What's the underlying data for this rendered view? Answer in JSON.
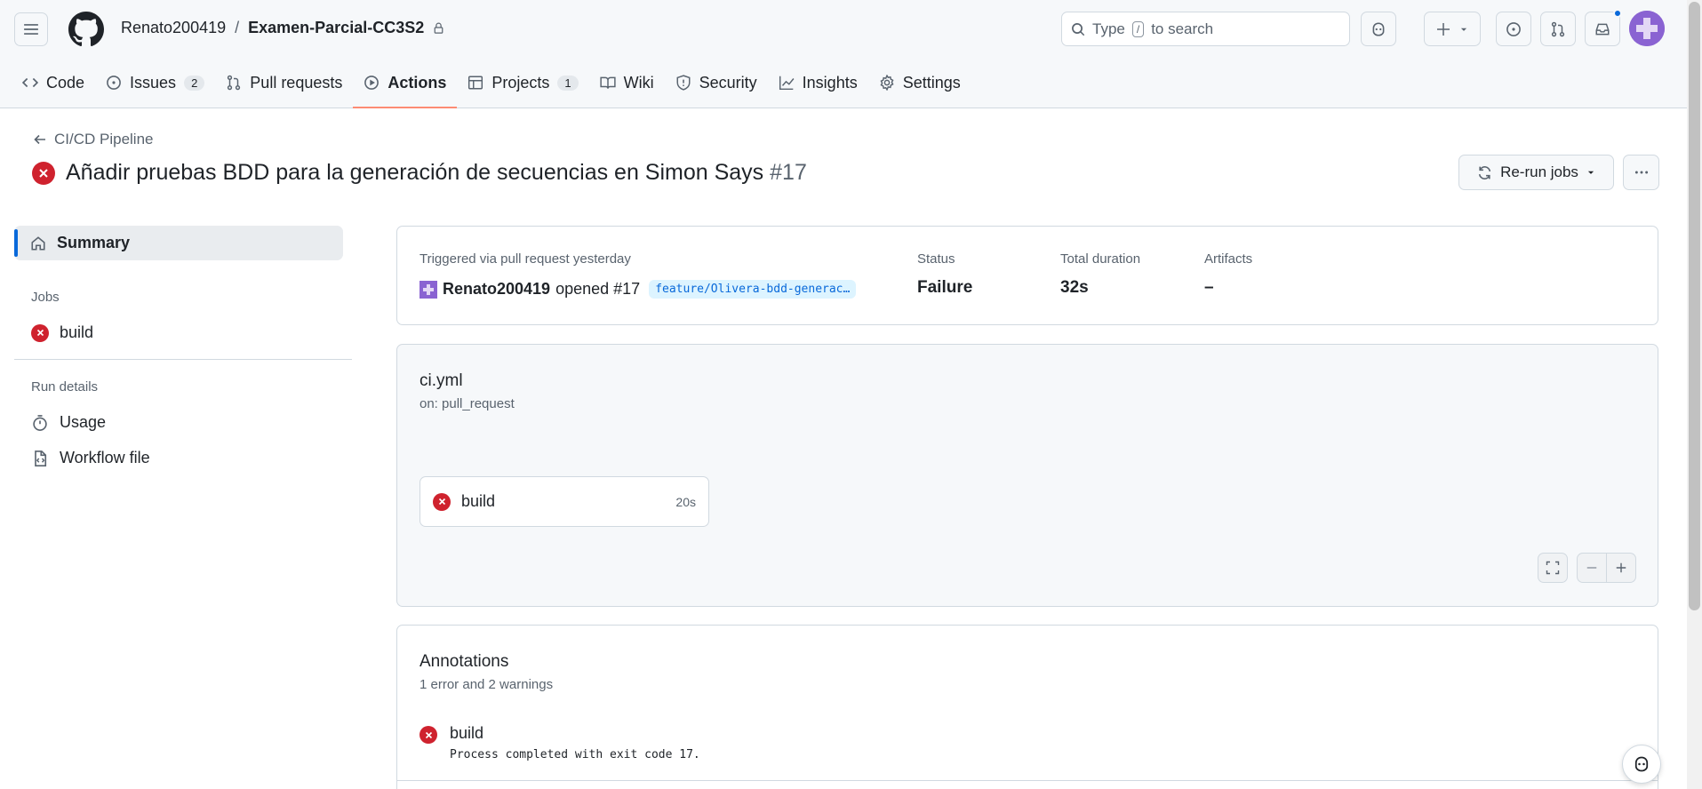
{
  "header": {
    "owner": "Renato200419",
    "separator": "/",
    "repo": "Examen-Parcial-CC3S2",
    "search_prefix": "Type",
    "search_key": "/",
    "search_suffix": "to search"
  },
  "tabs": [
    {
      "label": "Code",
      "count": null,
      "icon": "code-icon"
    },
    {
      "label": "Issues",
      "count": "2",
      "icon": "issue-icon"
    },
    {
      "label": "Pull requests",
      "count": null,
      "icon": "pull-request-icon"
    },
    {
      "label": "Actions",
      "count": null,
      "icon": "play-icon",
      "active": true
    },
    {
      "label": "Projects",
      "count": "1",
      "icon": "table-icon"
    },
    {
      "label": "Wiki",
      "count": null,
      "icon": "book-icon"
    },
    {
      "label": "Security",
      "count": null,
      "icon": "shield-icon"
    },
    {
      "label": "Insights",
      "count": null,
      "icon": "graph-icon"
    },
    {
      "label": "Settings",
      "count": null,
      "icon": "gear-icon"
    }
  ],
  "run": {
    "back_label": "CI/CD Pipeline",
    "title": "Añadir pruebas BDD para la generación de secuencias en Simon Says",
    "number": "#17",
    "rerun_label": "Re-run jobs"
  },
  "sidebar": {
    "summary": "Summary",
    "jobs_heading": "Jobs",
    "job": "build",
    "run_details_heading": "Run details",
    "usage": "Usage",
    "workflow_file": "Workflow file"
  },
  "summary": {
    "trigger_text": "Triggered via pull request yesterday",
    "actor": "Renato200419",
    "action": "opened #17",
    "branch": "feature/Olivera-bdd-generac…",
    "status_label": "Status",
    "status_value": "Failure",
    "duration_label": "Total duration",
    "duration_value": "32s",
    "artifacts_label": "Artifacts",
    "artifacts_value": "–"
  },
  "graph": {
    "workflow": "ci.yml",
    "trigger": "on: pull_request",
    "job_name": "build",
    "job_duration": "20s"
  },
  "annotations": {
    "title": "Annotations",
    "subtitle": "1 error and 2 warnings",
    "items": [
      {
        "title": "build",
        "message": "Process completed with exit code 17."
      }
    ]
  },
  "colors": {
    "failure": "#cf222e",
    "accent": "#0969da",
    "active_tab_underline": "#fd8c73"
  }
}
